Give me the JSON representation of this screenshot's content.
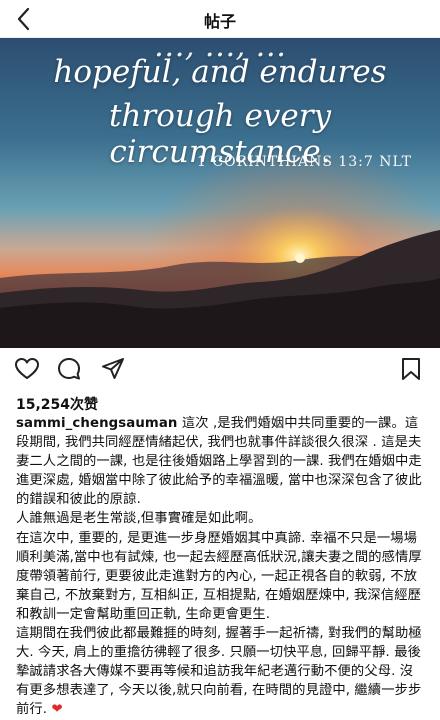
{
  "header": {
    "title": "帖子",
    "back_icon": "back-chevron-icon"
  },
  "post": {
    "image": {
      "verse_partial": "…, …, …",
      "verse_line1": "hopeful, and endures",
      "verse_line2": "through every circumstance.",
      "reference": "1 CORINTHIANS 13:7 NLT"
    },
    "actions": {
      "like_icon": "heart-icon",
      "comment_icon": "comment-icon",
      "share_icon": "share-icon",
      "save_icon": "bookmark-icon"
    },
    "likes": "15,254次赞",
    "username": "sammi_chengsauman",
    "caption": {
      "p1_intro": " 這次 ,是我們婚姻中共同重要的一課。這段期間, 我們共同經歷情緒起伏,  我們也就事件詳談很久很深 . 這是夫妻二人之間的一課, 也是往後婚姻路上學習到的一課. 我們在婚姻中走進更深處, 婚姻當中除了彼此給予的幸福溫暖, 當中也深深包含了彼此的錯誤和彼此的原諒.",
      "p2": "人誰無過是老生常談,但事實確是如此啊。",
      "p3": "在這次中, 重要的, 是更進一步身歷婚姻其中真諦. 幸福不只是一場場順利美滿,當中也有試煉, 也一起去經歷高低狀況,讓夫妻之間的感情厚度帶領著前行, 更要彼此走進對方的內心, 一起正視各自的軟弱, 不放棄自己, 不放棄對方, 互相糾正, 互相提點, 在婚姻歷煉中, 我深信經歷和教訓一定會幫助重回正軌, 生命更會更生.",
      "p4": "這期間在我們彼此都最難捱的時刻, 握著手一起祈禱, 對我們的幫助極大. 今天, 肩上的重擔彷彿輕了很多. 只願一切快平息, 回歸平靜.  最後摯誠請求各大傳媒不要再等候和追訪我年紀老邁行動不便的父母. 沒有更多想表達了, 今天以後,就只向前看, 在時間的見證中, 繼續一步步前行.",
      "end_emoji": "❤"
    }
  },
  "colors": {
    "heart": "#e02a2a",
    "sun": "#ffcf5a"
  }
}
